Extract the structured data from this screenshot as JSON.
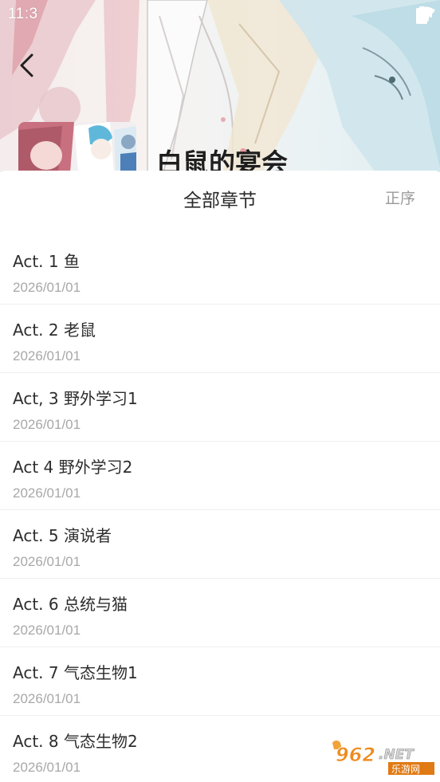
{
  "status_bar": {
    "time": "11:3",
    "icons": [
      "vibrate-icon",
      "wifi-icon",
      "battery-icon"
    ]
  },
  "header": {
    "back_icon": "chevron-left-icon",
    "comic_title": "白鼠的宴会"
  },
  "sheet": {
    "title": "全部章节",
    "sort_label": "正序"
  },
  "chapters": [
    {
      "title": "Act. 1 鱼",
      "date": "2026/01/01"
    },
    {
      "title": "Act. 2 老鼠",
      "date": "2026/01/01"
    },
    {
      "title": "Act, 3 野外学习1",
      "date": "2026/01/01"
    },
    {
      "title": "Act 4 野外学习2",
      "date": "2026/01/01"
    },
    {
      "title": "Act. 5 演说者",
      "date": "2026/01/01"
    },
    {
      "title": "Act. 6 总统与猫",
      "date": "2026/01/01"
    },
    {
      "title": "Act. 7 气态生物1",
      "date": "2026/01/01"
    },
    {
      "title": "Act. 8 气态生物2",
      "date": "2026/01/01"
    }
  ],
  "watermark": {
    "brand": "962.NET",
    "sub": "乐游网"
  },
  "colors": {
    "text_primary": "#2d2d2d",
    "text_secondary": "#a8a8a8",
    "divider": "#efefef",
    "watermark_orange": "#f08a1c"
  }
}
